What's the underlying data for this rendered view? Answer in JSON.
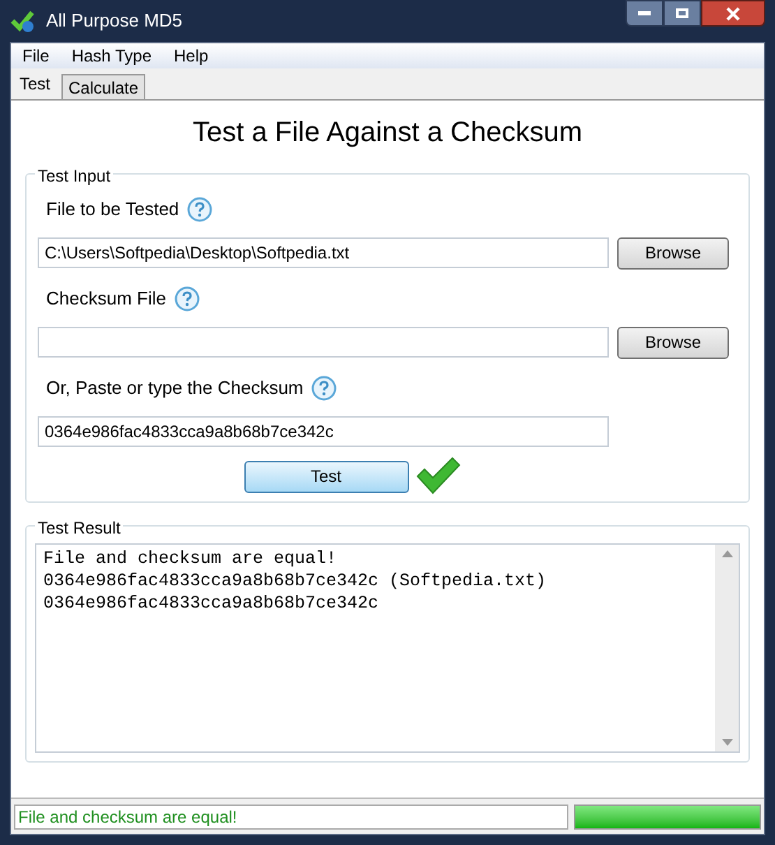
{
  "window": {
    "title": "All Purpose MD5"
  },
  "menu": [
    "File",
    "Hash Type",
    "Help"
  ],
  "tabs": [
    {
      "label": "Test",
      "selected": true
    },
    {
      "label": "Calculate",
      "selected": false
    }
  ],
  "heading": "Test a File Against a Checksum",
  "test_input": {
    "title": "Test Input",
    "fields": [
      {
        "label": "File to be Tested",
        "value": "C:\\Users\\Softpedia\\Desktop\\Softpedia.txt",
        "button": "Browse"
      },
      {
        "label": "Checksum File",
        "button": "Browse"
      },
      {
        "label": "Or, Paste or type the Checksum",
        "value": "0364e986fac4833cca9a8b68b7ce342c"
      }
    ],
    "test_button": "Test"
  },
  "test_result": {
    "title": "Test Result",
    "lines": [
      "File and checksum are equal!",
      "0364e986fac4833cca9a8b68b7ce342c (Softpedia.txt)",
      "0364e986fac4833cca9a8b68b7ce342c"
    ]
  },
  "status_bar": {
    "text": "File and checksum are equal!",
    "level": 1
  }
}
